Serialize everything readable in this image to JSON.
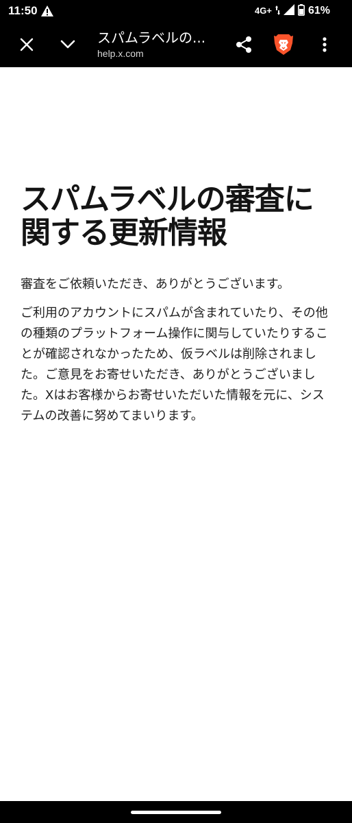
{
  "status_bar": {
    "time": "11:50",
    "network": "4G+",
    "battery": "61%",
    "icons": [
      "alert-icon",
      "signal-icon",
      "battery-icon"
    ]
  },
  "toolbar": {
    "page_title": "スパムラベルの...",
    "url": "help.x.com",
    "icons": [
      "close-icon",
      "chevron-down-icon",
      "share-icon",
      "brave-lion-icon",
      "more-vertical-icon"
    ],
    "brand_color": "#fb542b"
  },
  "article": {
    "heading": "スパムラベルの審査に関する更新情報",
    "paragraphs": [
      "審査をご依頼いただき、ありがとうございます。",
      "ご利用のアカウントにスパムが含まれていたり、その他の種類のプラットフォーム操作に関与していたりすることが確認されなかったため、仮ラベルは削除されました。ご意見をお寄せいただき、ありがとうございました。Xはお客様からお寄せいただいた情報を元に、システムの改善に努めてまいります。"
    ]
  }
}
